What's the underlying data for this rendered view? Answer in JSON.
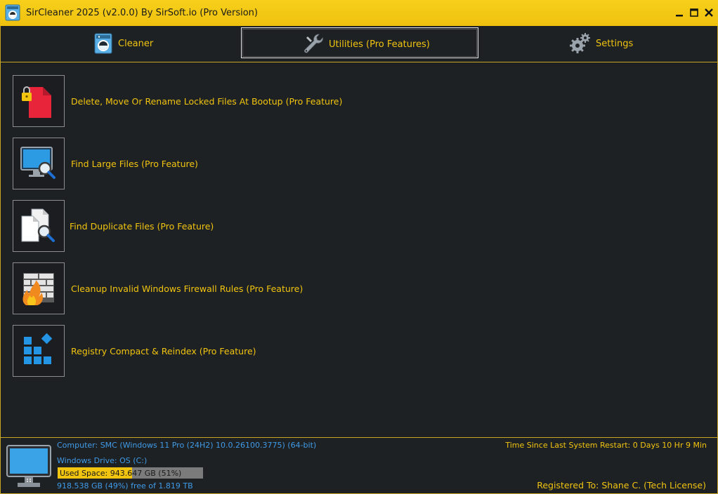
{
  "window": {
    "title": "SirCleaner 2025 (v2.0.0) By SirSoft.io (Pro Version)",
    "controls": [
      "minimize",
      "maximize",
      "close"
    ]
  },
  "tabs": [
    {
      "label": "Cleaner",
      "icon": "washing-machine-icon",
      "active": false
    },
    {
      "label": "Utilities (Pro Features)",
      "icon": "wrench-icon",
      "active": true
    },
    {
      "label": "Settings",
      "icon": "gears-icon",
      "active": false
    }
  ],
  "features": [
    {
      "label": "Delete, Move Or Rename Locked Files At Bootup (Pro Feature)",
      "icon": "locked-file-icon"
    },
    {
      "label": "Find Large Files (Pro Feature)",
      "icon": "monitor-search-icon"
    },
    {
      "label": "Find Duplicate Files (Pro Feature)",
      "icon": "duplicate-files-search-icon"
    },
    {
      "label": "Cleanup Invalid Windows Firewall Rules (Pro Feature)",
      "icon": "firewall-icon"
    },
    {
      "label": "Registry Compact & Reindex (Pro Feature)",
      "icon": "registry-blocks-icon"
    }
  ],
  "status": {
    "computer": "Computer: SMC (Windows 11 Pro (24H2) 10.0.26100.3775) (64-bit)",
    "drive": "Windows Drive: OS (C:)",
    "used_space": "Used Space: 943.647 GB (51%)",
    "used_fraction": 0.51,
    "free_space": "918.538 GB (49%) free of 1.819 TB",
    "uptime": "Time Since Last System Restart: 0 Days 10 Hr 9 Min",
    "registered": "Registered To: Shane C. (Tech License)"
  },
  "colors": {
    "accent": "#f1c40f",
    "background": "#1e2124",
    "info_text": "#3f9be8"
  }
}
